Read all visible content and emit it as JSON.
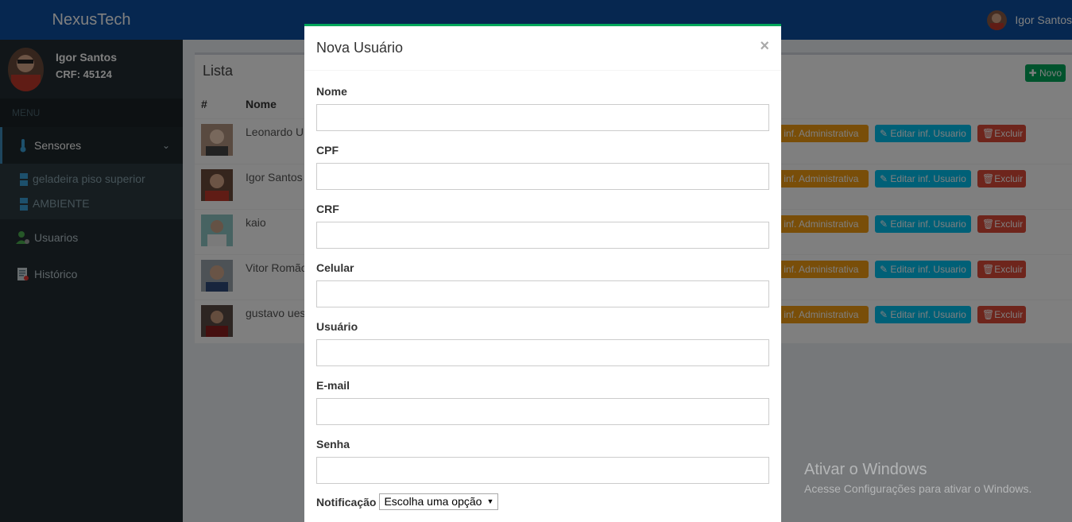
{
  "header": {
    "brand": "NexusTech",
    "user_name": "Igor Santos"
  },
  "sidebar": {
    "user_name": "Igor Santos",
    "user_crf": "CRF: 45124",
    "menu_header": "MENU",
    "items": [
      {
        "label": "Sensores",
        "icon": "thermometer-icon"
      },
      {
        "label": "Usuarios",
        "icon": "user-gear-icon"
      },
      {
        "label": "Histórico",
        "icon": "report-icon"
      }
    ],
    "sensors": [
      "geladeira piso superior",
      "AMBIENTE"
    ]
  },
  "list": {
    "title": "Lista",
    "new_button": "Novo",
    "columns": [
      "#",
      "Nome"
    ],
    "rows": [
      {
        "name": "Leonardo U"
      },
      {
        "name": "Igor Santos"
      },
      {
        "name": "kaio"
      },
      {
        "name": "Vitor Romão"
      },
      {
        "name": "gustavo ues"
      }
    ],
    "actions": {
      "admin": "r inf. Administrativa",
      "user": "Editar inf. Usuario",
      "delete": "Excluir"
    }
  },
  "modal": {
    "title": "Nova Usuário",
    "close": "×",
    "fields": [
      {
        "label": "Nome",
        "value": ""
      },
      {
        "label": "CPF",
        "value": ""
      },
      {
        "label": "CRF",
        "value": ""
      },
      {
        "label": "Celular",
        "value": ""
      },
      {
        "label": "Usuário",
        "value": ""
      },
      {
        "label": "E-mail",
        "value": ""
      },
      {
        "label": "Senha",
        "value": ""
      }
    ],
    "notification_label": "Notificação",
    "notification_select": "Escolha uma opção"
  },
  "watermark": {
    "line1": "Ativar o Windows",
    "line2": "Acesse Configurações para ativar o Windows."
  },
  "colors": {
    "header": "#0c4fa0",
    "sidebar": "#222d32",
    "accent_green": "#00a65a",
    "btn_warning": "#f39c12",
    "btn_info": "#00c0ef",
    "btn_danger": "#dd4b39"
  }
}
